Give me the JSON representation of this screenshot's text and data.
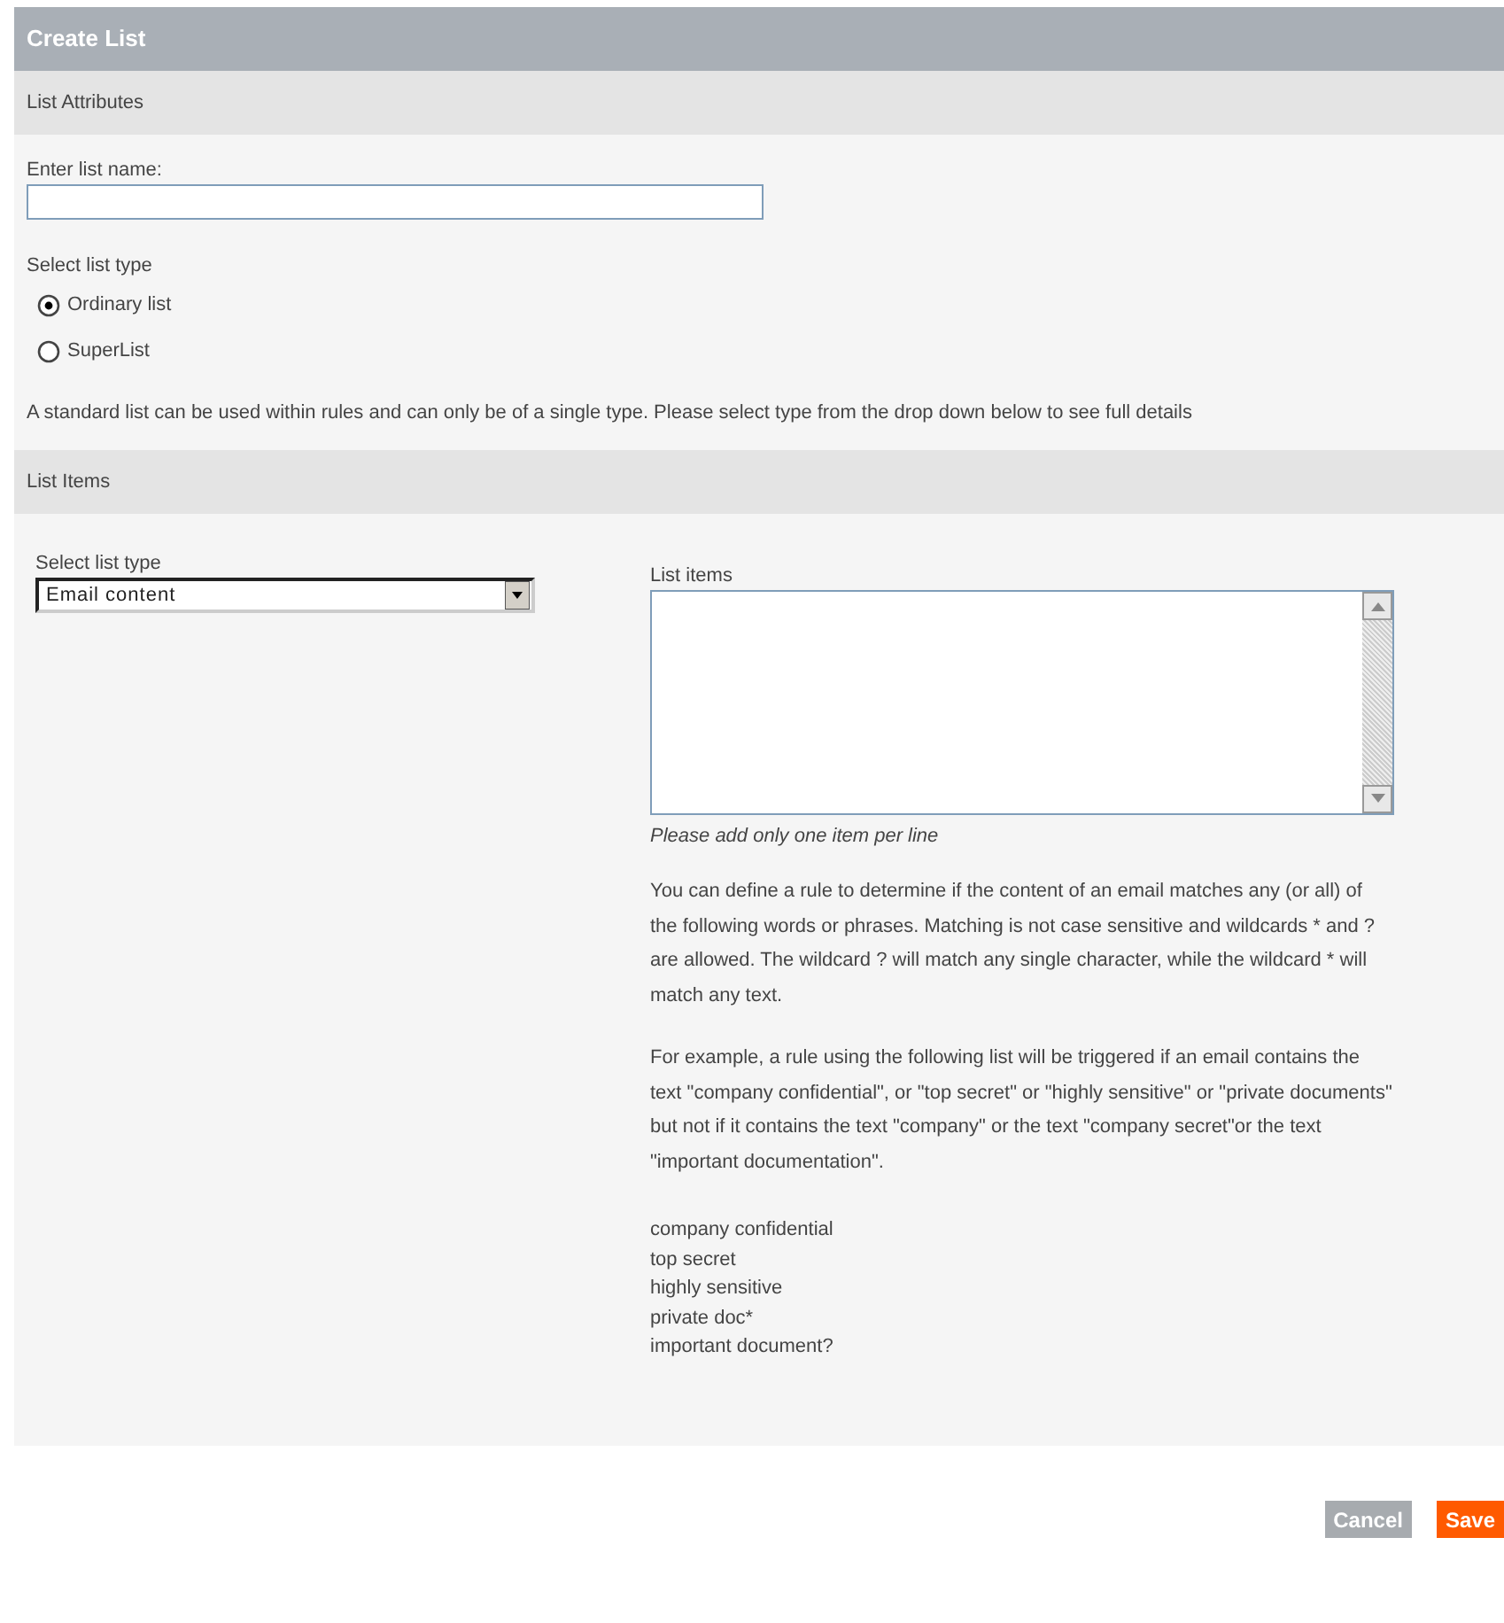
{
  "title": "Create List",
  "attributes": {
    "heading": "List Attributes",
    "name_label": "Enter list name:",
    "type_label": "Select list type",
    "options": [
      {
        "label": "Ordinary list",
        "selected": true
      },
      {
        "label": "SuperList",
        "selected": false
      }
    ],
    "description": "A standard list can be used within rules and can only be of a single type. Please select type from the drop down below to see full details"
  },
  "items": {
    "heading": "List Items",
    "type_label": "Select list type",
    "type_value": "Email content",
    "list_label": "List items",
    "hint": "Please add only one item per line",
    "paragraphs": [
      "You can define a rule to determine if the content of an email matches any (or all) of the following words or phrases. Matching is not case sensitive and wildcards * and ? are allowed. The wildcard ? will match any single character, while the wildcard * will match any text.",
      "For example, a rule using the following list will be triggered if an email contains the text \"company confidential\", or \"top secret\" or \"highly sensitive\" or \"private documents\" but not if it contains the text \"company\" or the text \"company secret\"or the text \"important documentation\"."
    ],
    "examples": [
      "company confidential",
      "top secret",
      "highly sensitive",
      "private doc*",
      "important document?"
    ]
  },
  "buttons": [
    {
      "label": "Cancel",
      "kind": "secondary"
    },
    {
      "label": "Save",
      "kind": "primary"
    }
  ]
}
